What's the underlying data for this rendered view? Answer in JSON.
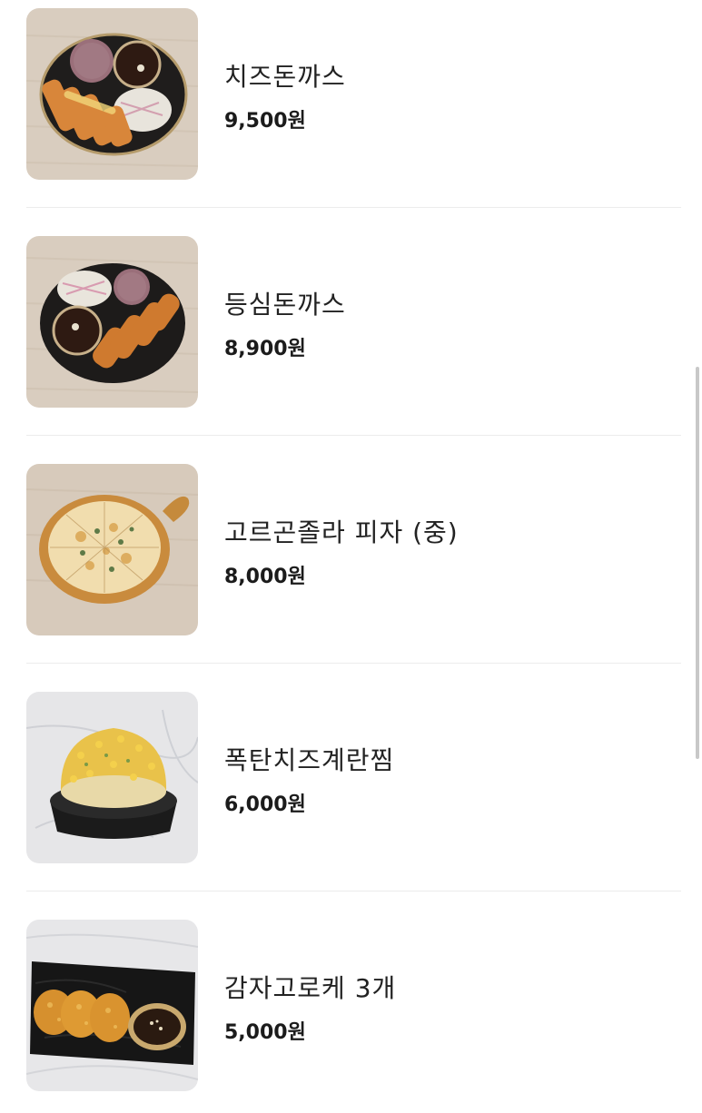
{
  "menu": {
    "items": [
      {
        "name": "치즈돈까스",
        "price": "9,500원",
        "image_icon": "cheese-pork-cutlet-photo"
      },
      {
        "name": "등심돈까스",
        "price": "8,900원",
        "image_icon": "pork-loin-cutlet-photo"
      },
      {
        "name": "고르곤졸라 피자 (중)",
        "price": "8,000원",
        "image_icon": "gorgonzola-pizza-photo"
      },
      {
        "name": "폭탄치즈계란찜",
        "price": "6,000원",
        "image_icon": "bomb-cheese-steamed-egg-photo"
      },
      {
        "name": "감자고로케 3개",
        "price": "5,000원",
        "image_icon": "potato-croquette-photo"
      }
    ]
  }
}
